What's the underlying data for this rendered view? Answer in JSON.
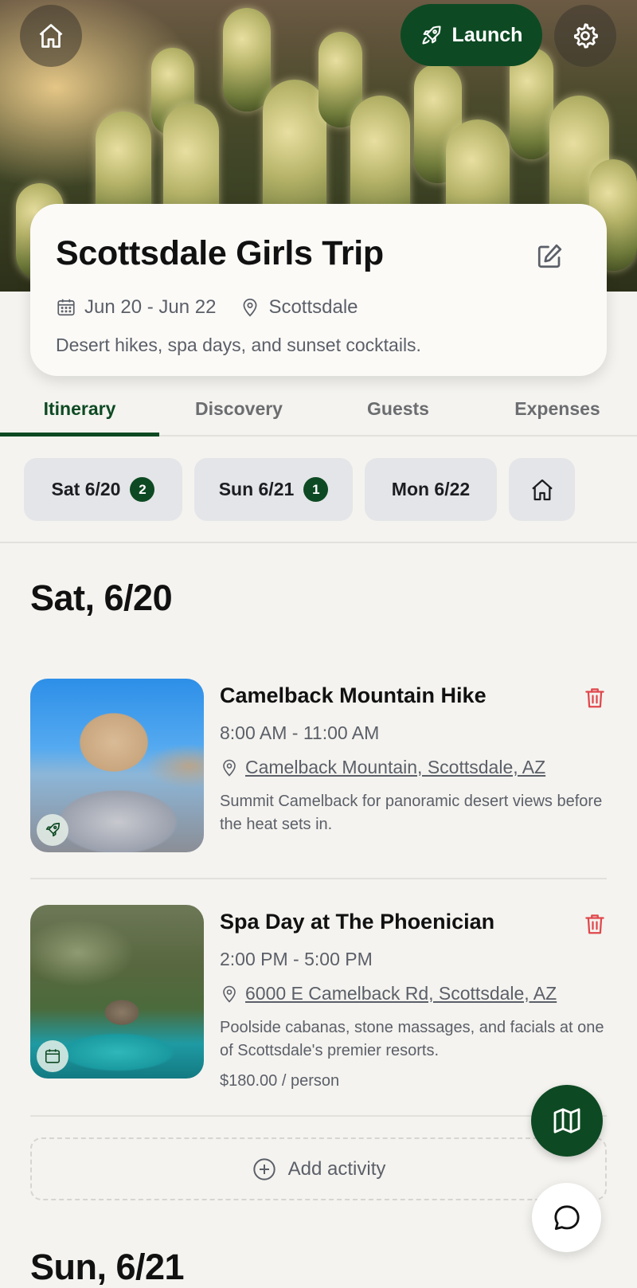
{
  "hero": {
    "launch_label": "Launch",
    "icons": [
      "home-icon",
      "rocket-icon",
      "gear-icon"
    ]
  },
  "trip": {
    "title": "Scottsdale Girls Trip",
    "dates": "Jun 20 - Jun 22",
    "location": "Scottsdale",
    "description": "Desert hikes, spa days, and sunset cocktails."
  },
  "tabs": [
    {
      "label": "Itinerary",
      "active": true
    },
    {
      "label": "Discovery",
      "active": false
    },
    {
      "label": "Guests",
      "active": false
    },
    {
      "label": "Expenses",
      "active": false
    }
  ],
  "day_chips": [
    {
      "label": "Sat 6/20",
      "count": "2"
    },
    {
      "label": "Sun 6/21",
      "count": "1"
    },
    {
      "label": "Mon 6/22",
      "count": ""
    }
  ],
  "days": [
    {
      "heading": "Sat, 6/20",
      "activities": [
        {
          "title": "Camelback Mountain Hike",
          "time": "8:00 AM - 11:00 AM",
          "location": "Camelback Mountain, Scottsdale, AZ",
          "description": "Summit Camelback for panoramic desert views before the heat sets in.",
          "price": "",
          "badge_icon": "rocket-icon"
        },
        {
          "title": "Spa Day at The Phoenician",
          "time": "2:00 PM - 5:00 PM",
          "location": "6000 E Camelback Rd, Scottsdale, AZ",
          "description": "Poolside cabanas, stone massages, and facials at one of Scottsdale's premier resorts.",
          "price": "$180.00 / person",
          "badge_icon": "calendar-icon"
        }
      ],
      "add_label": "Add activity"
    },
    {
      "heading": "Sun, 6/21"
    }
  ],
  "colors": {
    "brand": "#0d4a23",
    "danger": "#e0474c",
    "muted": "#5b5f68",
    "background": "#f4f3ef"
  }
}
